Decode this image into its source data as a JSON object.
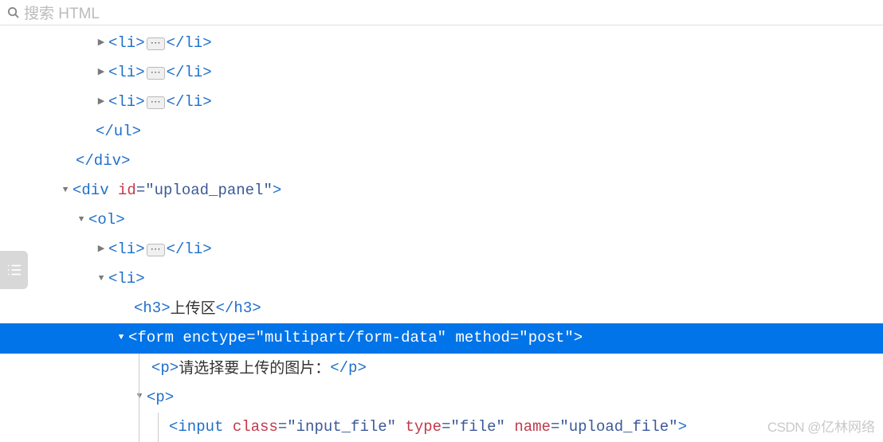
{
  "search": {
    "placeholder": "搜索 HTML"
  },
  "tree": {
    "li_collapsed_open": "<li>",
    "li_collapsed_close": "</li>",
    "ul_close": "</ul>",
    "div_close": "</div>",
    "div_open": "<div",
    "div_id_attr": " id",
    "div_id_val": "=\"upload_panel\"",
    "div_open_end": ">",
    "ol_open": "<ol>",
    "li_open": "<li>",
    "h3_open": "<h3>",
    "h3_text": "上传区",
    "h3_close": "</h3>",
    "form_open": "<form",
    "form_enctype_attr": " enctype",
    "form_enctype_val": "=\"multipart/form-data\"",
    "form_method_attr": " method",
    "form_method_val": "=\"post\"",
    "form_open_end": ">",
    "p_open": "<p>",
    "p_text": "请选择要上传的图片：",
    "p_close": "</p>",
    "input_open": "<input",
    "input_class_attr": " class",
    "input_class_val": "=\"input_file\"",
    "input_type_attr": " type",
    "input_type_val": "=\"file\"",
    "input_name_attr": " name",
    "input_name_val": "=\"upload_file\"",
    "input_end": ">"
  },
  "watermark": {
    "part1": "CSDN @",
    "part2": "亿林网络"
  }
}
